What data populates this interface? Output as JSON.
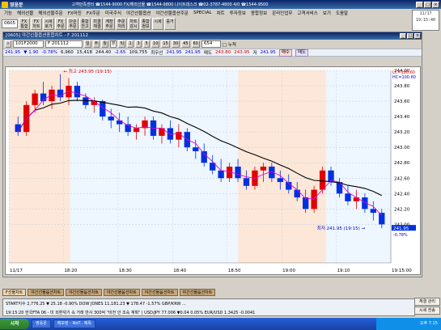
{
  "app": {
    "title": "영웅문",
    "ticker": "고객만족센터 ☎1544-9000  FX/해외선물 ☎1544-9800  나이트데스크 ☎02-3787-4800  4/0 ☎1544-9500",
    "clock": [
      "",
      "11/17",
      "",
      "19:15:40"
    ]
  },
  "menu": [
    "기능",
    "해외선물",
    "해외선물주문",
    "FX마진",
    "FX주문",
    "미국주식",
    "야간선물옵션",
    "야간선물옵션주문",
    "SPECIAL",
    "차트",
    "투자정보",
    "종합정보",
    "온라인업무",
    "고객서비스",
    "보기",
    "도움말"
  ],
  "toolbar": {
    "code": "0605",
    "buttons": [
      {
        "top": "FX",
        "bottom": "통합"
      },
      {
        "top": "FX",
        "bottom": "차트"
      },
      {
        "top": "시세",
        "bottom": "호가"
      },
      {
        "top": "FX",
        "bottom": "주문"
      },
      {
        "top": "단순",
        "bottom": "주문"
      },
      {
        "top": "종합",
        "bottom": "잔고"
      },
      {
        "top": "미결",
        "bottom": "체결"
      },
      {
        "top": "계좌",
        "bottom": "주문"
      },
      {
        "top": "주문",
        "bottom": "처리"
      },
      {
        "top": "차트",
        "bottom": "감시"
      },
      {
        "top": "종합",
        "bottom": "정보"
      },
      {
        "top": "시세",
        "bottom": ""
      },
      {
        "top": "증거",
        "bottom": ""
      }
    ]
  },
  "chart_window": {
    "title": "[0605] 야간선물옵션종합차트 - F 201112",
    "code_field": "101F2000",
    "period_buttons": [
      "일",
      "주",
      "월",
      "분",
      "틱",
      "1",
      "3",
      "5",
      "10",
      "15",
      "30",
      "45",
      "60"
    ],
    "count_field": "654",
    "checkbox_label": "□ 누적",
    "quote": {
      "price": "241.95",
      "change": "▼ 1.90",
      "rate": "-0.78%",
      "volume": "6,960",
      "amount": "15,418",
      "high": "244.40",
      "high_chg": "-2.65",
      "open_int": "109,755",
      "sell_label": "최우선",
      "ask": "241.95",
      "bid_b": "241.95",
      "bid_label": "매도",
      "bid1": "243.80",
      "bid2": "243.95",
      "bid_tag": "저",
      "low": "241.95",
      "buy_btn": "매수",
      "sell_btn": "매도"
    },
    "legend": "F 201112"
  },
  "chart_data": {
    "type": "candlestick",
    "title": "",
    "ylim": [
      241.5,
      244.0
    ],
    "y_ticks": [
      242.0,
      242.2,
      242.4,
      242.6,
      242.8,
      243.0,
      243.2,
      243.4,
      243.6,
      243.8,
      244.0
    ],
    "x_ticks": [
      "11/17",
      "18:20",
      "18:30",
      "18:40",
      "18:50",
      "19:00",
      "19:10",
      "19:15:00"
    ],
    "annotations": {
      "high": "최고 243.95 (19:15)",
      "low": "최저 241.95 (19:15)"
    },
    "right_labels": {
      "lc": "LC=100.60",
      "hc": "HC=100.60",
      "last": "241.95",
      "pct": "-0.78%"
    },
    "candles": [
      {
        "o": 243.3,
        "h": 243.4,
        "l": 243.15,
        "c": 243.2
      },
      {
        "o": 243.2,
        "h": 243.6,
        "l": 243.15,
        "c": 243.55
      },
      {
        "o": 243.55,
        "h": 243.75,
        "l": 243.45,
        "c": 243.7
      },
      {
        "o": 243.7,
        "h": 243.85,
        "l": 243.55,
        "c": 243.6
      },
      {
        "o": 243.6,
        "h": 243.8,
        "l": 243.5,
        "c": 243.75
      },
      {
        "o": 243.75,
        "h": 243.95,
        "l": 243.6,
        "c": 243.65
      },
      {
        "o": 243.65,
        "h": 243.9,
        "l": 243.55,
        "c": 243.8
      },
      {
        "o": 243.8,
        "h": 243.85,
        "l": 243.6,
        "c": 243.65
      },
      {
        "o": 243.65,
        "h": 243.7,
        "l": 243.5,
        "c": 243.55
      },
      {
        "o": 243.55,
        "h": 243.65,
        "l": 243.45,
        "c": 243.6
      },
      {
        "o": 243.6,
        "h": 243.62,
        "l": 243.35,
        "c": 243.4
      },
      {
        "o": 243.4,
        "h": 243.5,
        "l": 243.25,
        "c": 243.35
      },
      {
        "o": 243.35,
        "h": 243.45,
        "l": 243.2,
        "c": 243.3
      },
      {
        "o": 243.3,
        "h": 243.4,
        "l": 243.15,
        "c": 243.2
      },
      {
        "o": 243.2,
        "h": 243.3,
        "l": 243.1,
        "c": 243.25
      },
      {
        "o": 243.25,
        "h": 243.4,
        "l": 243.15,
        "c": 243.35
      },
      {
        "o": 243.35,
        "h": 243.4,
        "l": 243.1,
        "c": 243.15
      },
      {
        "o": 243.15,
        "h": 243.3,
        "l": 243.05,
        "c": 243.25
      },
      {
        "o": 243.25,
        "h": 243.35,
        "l": 243.05,
        "c": 243.1
      },
      {
        "o": 243.1,
        "h": 243.3,
        "l": 243.0,
        "c": 243.2
      },
      {
        "o": 243.2,
        "h": 243.25,
        "l": 242.95,
        "c": 243.0
      },
      {
        "o": 243.0,
        "h": 243.1,
        "l": 242.85,
        "c": 242.95
      },
      {
        "o": 242.95,
        "h": 243.05,
        "l": 242.75,
        "c": 242.8
      },
      {
        "o": 242.8,
        "h": 242.9,
        "l": 242.65,
        "c": 242.7
      },
      {
        "o": 242.7,
        "h": 242.85,
        "l": 242.55,
        "c": 242.6
      },
      {
        "o": 242.6,
        "h": 242.8,
        "l": 242.55,
        "c": 242.75
      },
      {
        "o": 242.75,
        "h": 242.85,
        "l": 242.55,
        "c": 242.6
      },
      {
        "o": 242.6,
        "h": 242.7,
        "l": 242.45,
        "c": 242.5
      },
      {
        "o": 242.5,
        "h": 242.75,
        "l": 242.45,
        "c": 242.7
      },
      {
        "o": 242.7,
        "h": 242.8,
        "l": 242.55,
        "c": 242.75
      },
      {
        "o": 242.75,
        "h": 242.8,
        "l": 242.55,
        "c": 242.6
      },
      {
        "o": 242.6,
        "h": 242.7,
        "l": 242.45,
        "c": 242.55
      },
      {
        "o": 242.55,
        "h": 242.65,
        "l": 242.4,
        "c": 242.45
      },
      {
        "o": 242.45,
        "h": 242.55,
        "l": 242.3,
        "c": 242.35
      },
      {
        "o": 242.35,
        "h": 242.45,
        "l": 242.15,
        "c": 242.2
      },
      {
        "o": 242.2,
        "h": 242.5,
        "l": 242.15,
        "c": 242.45
      },
      {
        "o": 242.45,
        "h": 242.75,
        "l": 242.4,
        "c": 242.7
      },
      {
        "o": 242.7,
        "h": 242.75,
        "l": 242.5,
        "c": 242.55
      },
      {
        "o": 242.55,
        "h": 242.6,
        "l": 242.35,
        "c": 242.4
      },
      {
        "o": 242.4,
        "h": 242.5,
        "l": 242.25,
        "c": 242.3
      },
      {
        "o": 242.3,
        "h": 242.45,
        "l": 242.2,
        "c": 242.35
      },
      {
        "o": 242.35,
        "h": 242.4,
        "l": 242.15,
        "c": 242.2
      },
      {
        "o": 242.2,
        "h": 242.3,
        "l": 242.05,
        "c": 242.15
      },
      {
        "o": 242.15,
        "h": 242.2,
        "l": 241.95,
        "c": 242.0
      }
    ],
    "series": [
      {
        "name": "MA5",
        "color": "#e000e0"
      },
      {
        "name": "MA20",
        "color": "#000000"
      }
    ]
  },
  "bottom_tabs": [
    "F선물차트",
    "야간선물옵션차트",
    "야간선물옵션차트",
    "야간선물옵션차트",
    "야간선물옵션차트",
    "야간선물옵션차트"
  ],
  "status": {
    "line1": "START지수   2,776.25  ▼ 25.18  -0.90%   DOW JONES   11,181.23  ▼ 178.47  -1.57%   GBP/KRW  ...",
    "line2": "19:15:20  한국FTA 06 - 미 외환위기 속 거래 반사 300억 \"비전 안 조숙 계획\"   |   USD/JPY  77.006  ▼0.04  0.05%   EUR/USD  1.3425  -0.0041"
  },
  "side_buttons": [
    "체결 관리",
    "시세 전송"
  ],
  "taskbar": {
    "start": "시작",
    "items": [
      "영웅문",
      "메모장 - NoT.. 제목"
    ],
    "tray": "오후 7:15"
  }
}
